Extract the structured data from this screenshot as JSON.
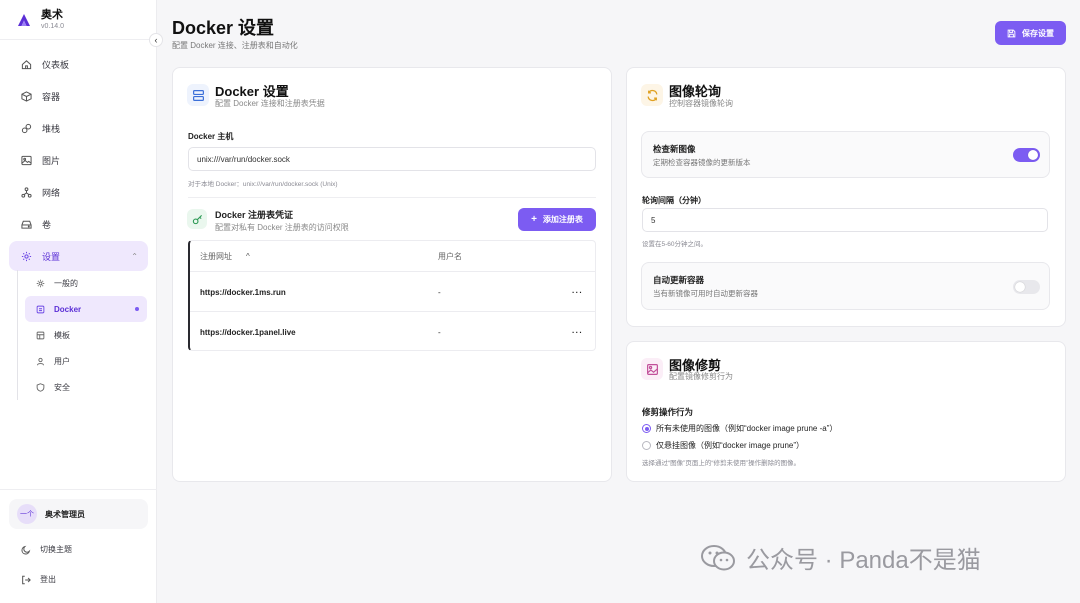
{
  "app": {
    "name": "奥术",
    "version": "v0.14.0"
  },
  "sidebar": {
    "items": [
      {
        "label": "仪表板",
        "icon": "home-icon"
      },
      {
        "label": "容器",
        "icon": "box-icon"
      },
      {
        "label": "堆栈",
        "icon": "layers-icon"
      },
      {
        "label": "图片",
        "icon": "image-icon"
      },
      {
        "label": "网络",
        "icon": "network-icon"
      },
      {
        "label": "卷",
        "icon": "drive-icon"
      },
      {
        "label": "设置",
        "icon": "gear-icon",
        "active": true,
        "expanded": true
      }
    ],
    "subitems": [
      {
        "label": "一般的",
        "icon": "gear-icon"
      },
      {
        "label": "Docker",
        "icon": "docker-icon",
        "active": true
      },
      {
        "label": "模板",
        "icon": "template-icon"
      },
      {
        "label": "用户",
        "icon": "user-icon"
      },
      {
        "label": "安全",
        "icon": "shield-icon"
      }
    ],
    "user": {
      "avatar_text": "一个",
      "name": "奥术管理员"
    },
    "theme_toggle": "切换主题",
    "logout": "登出"
  },
  "header": {
    "title": "Docker 设置",
    "subtitle": "配置 Docker 连接、注册表和自动化",
    "save_label": "保存设置"
  },
  "docker_card": {
    "title": "Docker 设置",
    "subtitle": "配置 Docker 连接和注册表凭据",
    "host_label": "Docker 主机",
    "host_value": "unix:///var/run/docker.sock",
    "host_hint": "对于本地 Docker：unix:///var/run/docker.sock (Unix)",
    "registry": {
      "title": "Docker 注册表凭证",
      "subtitle": "配置对私有 Docker 注册表的访问权限",
      "add_label": "添加注册表",
      "columns": [
        "注册网址",
        "用户名"
      ],
      "sort_icon": "^",
      "rows": [
        {
          "url": "https://docker.1ms.run",
          "username": "-",
          "actions": "···"
        },
        {
          "url": "https://docker.1panel.live",
          "username": "-",
          "actions": "···"
        }
      ]
    }
  },
  "polling_card": {
    "title": "图像轮询",
    "subtitle": "控制容器镜像轮询",
    "check_title": "检查新图像",
    "check_sub": "定期检查容器镜像的更新版本",
    "check_enabled": true,
    "interval_label": "轮询间隔（分钟）",
    "interval_value": "5",
    "interval_hint": "设置在5-60分钟之间。",
    "auto_title": "自动更新容器",
    "auto_sub": "当有新镜像可用时自动更新容器",
    "auto_enabled": false
  },
  "prune_card": {
    "title": "图像修剪",
    "subtitle": "配置镜像修剪行为",
    "action_label": "修剪操作行为",
    "options": [
      {
        "label": "所有未使用的图像（例如“docker image prune -a”）",
        "checked": true
      },
      {
        "label": "仅悬挂图像（例如“docker image prune”）",
        "checked": false
      }
    ],
    "hint": "选择通过“图像”页面上的“修剪未使用”操作删除的图像。"
  },
  "watermark": {
    "text": "公众号 · Panda不是猫"
  },
  "colors": {
    "accent": "#7c5cf2",
    "accent_light": "#efe8fd"
  }
}
